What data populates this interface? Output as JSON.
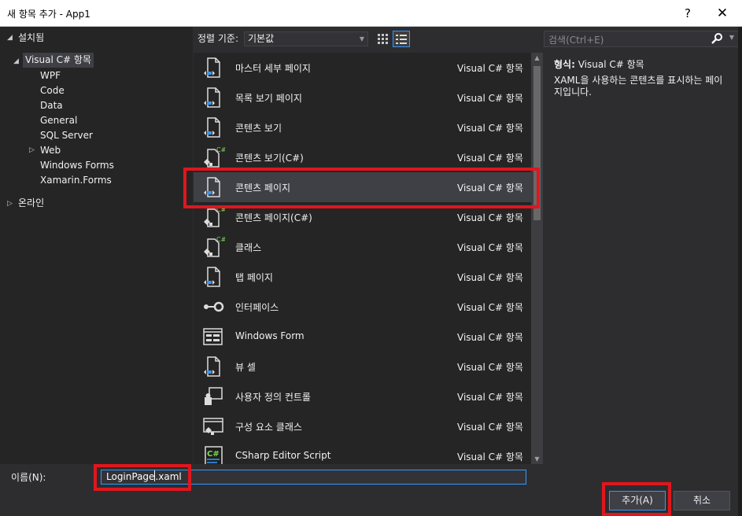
{
  "window": {
    "title": "새 항목 추가 - App1",
    "help": "?",
    "close": "✕"
  },
  "tree": {
    "installed": "설치됨",
    "visual_cs": "Visual C# 항목",
    "children": [
      "WPF",
      "Code",
      "Data",
      "General",
      "SQL Server",
      "Web",
      "Windows Forms",
      "Xamarin.Forms"
    ],
    "online": "온라인"
  },
  "toolbar": {
    "sort_label": "정렬 기준:",
    "sort_value": "기본값"
  },
  "search": {
    "placeholder": "검색(Ctrl+E)"
  },
  "items": [
    {
      "name": "마스터 세부 페이지",
      "type": "Visual C# 항목",
      "icon": "xaml-page-icon"
    },
    {
      "name": "목록 보기 페이지",
      "type": "Visual C# 항목",
      "icon": "xaml-page-icon"
    },
    {
      "name": "콘텐츠 보기",
      "type": "Visual C# 항목",
      "icon": "xaml-page-icon"
    },
    {
      "name": "콘텐츠 보기(C#)",
      "type": "Visual C# 항목",
      "icon": "csharp-class-icon"
    },
    {
      "name": "콘텐츠 페이지",
      "type": "Visual C# 항목",
      "icon": "xaml-page-icon"
    },
    {
      "name": "콘텐츠 페이지(C#)",
      "type": "Visual C# 항목",
      "icon": "csharp-class-icon"
    },
    {
      "name": "클래스",
      "type": "Visual C# 항목",
      "icon": "csharp-class-icon"
    },
    {
      "name": "탭 페이지",
      "type": "Visual C# 항목",
      "icon": "xaml-page-icon"
    },
    {
      "name": "인터페이스",
      "type": "Visual C# 항목",
      "icon": "interface-icon"
    },
    {
      "name": "Windows Form",
      "type": "Visual C# 항목",
      "icon": "windows-form-icon"
    },
    {
      "name": "뷰 셀",
      "type": "Visual C# 항목",
      "icon": "xaml-page-icon"
    },
    {
      "name": "사용자 정의 컨트롤",
      "type": "Visual C# 항목",
      "icon": "user-control-icon"
    },
    {
      "name": "구성 요소 클래스",
      "type": "Visual C# 항목",
      "icon": "component-class-icon"
    },
    {
      "name": "CSharp Editor Script",
      "type": "Visual C# 항목",
      "icon": "csharp-script-icon"
    }
  ],
  "selected_index": 4,
  "details": {
    "type_label": "형식:",
    "type_value": "Visual C# 항목",
    "description": "XAML을 사용하는 콘텐츠를 표시하는 페이지입니다."
  },
  "bottom": {
    "name_label": "이름(N):",
    "name_value_before_caret": "LoginPage",
    "name_value_after_caret": ".xaml",
    "add_button": "추가(A)",
    "cancel_button": "취소"
  },
  "colors": {
    "highlight": "#e0161d",
    "accent": "#3399ff",
    "background": "#2d2d30",
    "panel": "#252526"
  }
}
